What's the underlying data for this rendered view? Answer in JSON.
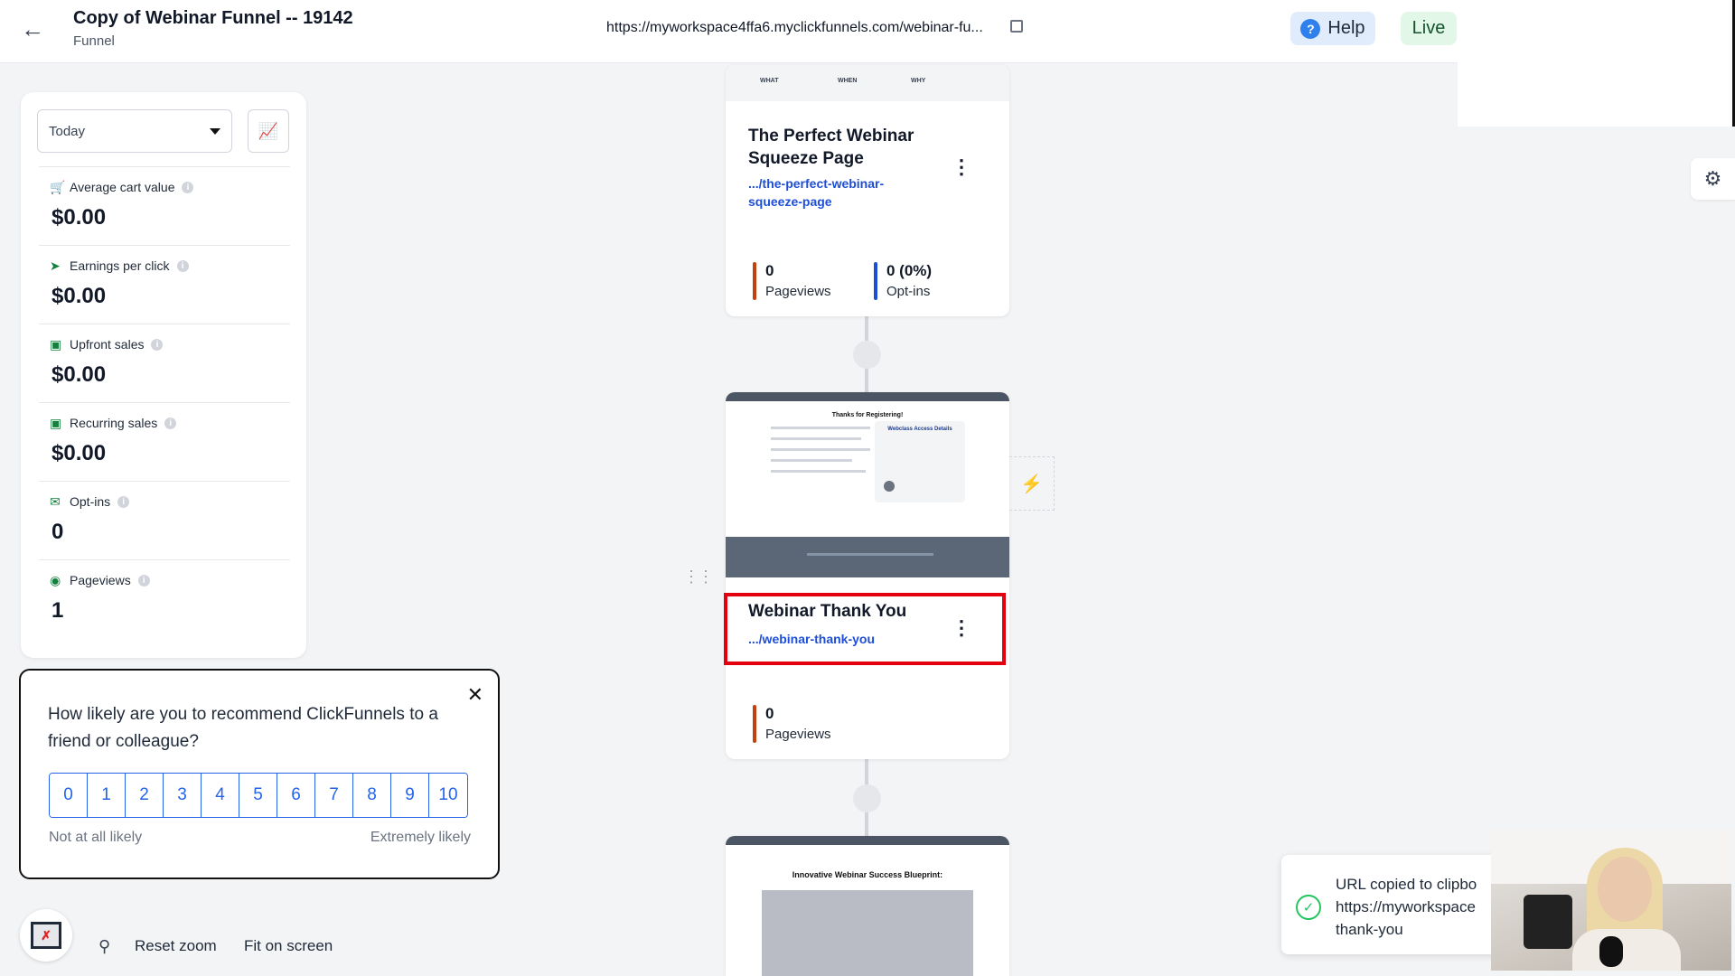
{
  "header": {
    "title": "Copy of Webinar Funnel -- 19142",
    "subtitle": "Funnel",
    "url": "https://myworkspace4ffa6.myclickfunnels.com/webinar-fu...",
    "help_label": "Help",
    "live_label": "Live"
  },
  "stats": {
    "date_range": "Today",
    "items": [
      {
        "label": "Average cart value",
        "value": "$0.00",
        "icon": "cart-icon"
      },
      {
        "label": "Earnings per click",
        "value": "$0.00",
        "icon": "cursor-icon"
      },
      {
        "label": "Upfront sales",
        "value": "$0.00",
        "icon": "money-icon"
      },
      {
        "label": "Recurring sales",
        "value": "$0.00",
        "icon": "money-icon"
      },
      {
        "label": "Opt-ins",
        "value": "0",
        "icon": "envelope-icon"
      },
      {
        "label": "Pageviews",
        "value": "1",
        "icon": "eye-icon"
      }
    ]
  },
  "cards": [
    {
      "title_line1": "The Perfect Webinar",
      "title_line2": "Squeeze Page",
      "link_line1": ".../the-perfect-webinar-",
      "link_line2": "squeeze-page",
      "thumb_labels": [
        "WHAT",
        "WHEN",
        "WHY"
      ],
      "metrics": [
        {
          "value": "0",
          "label": "Pageviews",
          "color": "#c2410c"
        },
        {
          "value": "0 (0%)",
          "label": "Opt-ins",
          "color": "#1d4ed8"
        }
      ]
    },
    {
      "title": "Webinar Thank You",
      "link": ".../webinar-thank-you",
      "thumb_heading": "Thanks for Registering!",
      "thumb_box": "Webclass Access Details",
      "metrics": [
        {
          "value": "0",
          "label": "Pageviews",
          "color": "#c2410c"
        }
      ]
    },
    {
      "thumb_heading": "Innovative Webinar Success Blueprint:"
    }
  ],
  "survey": {
    "question": "How likely are you to recommend ClickFunnels to a friend or colleague?",
    "scale": [
      "0",
      "1",
      "2",
      "3",
      "4",
      "5",
      "6",
      "7",
      "8",
      "9",
      "10"
    ],
    "low_label": "Not at all likely",
    "high_label": "Extremely likely"
  },
  "toolbar": {
    "reset_zoom": "Reset zoom",
    "fit_screen": "Fit on screen"
  },
  "toast": {
    "line1": "URL copied to clipbo",
    "line2": "https://myworkspace",
    "line3": "thank-you"
  },
  "colors": {
    "accent": "#2563eb",
    "highlight": "#e3000f",
    "live_bg": "#e3f7e9"
  }
}
